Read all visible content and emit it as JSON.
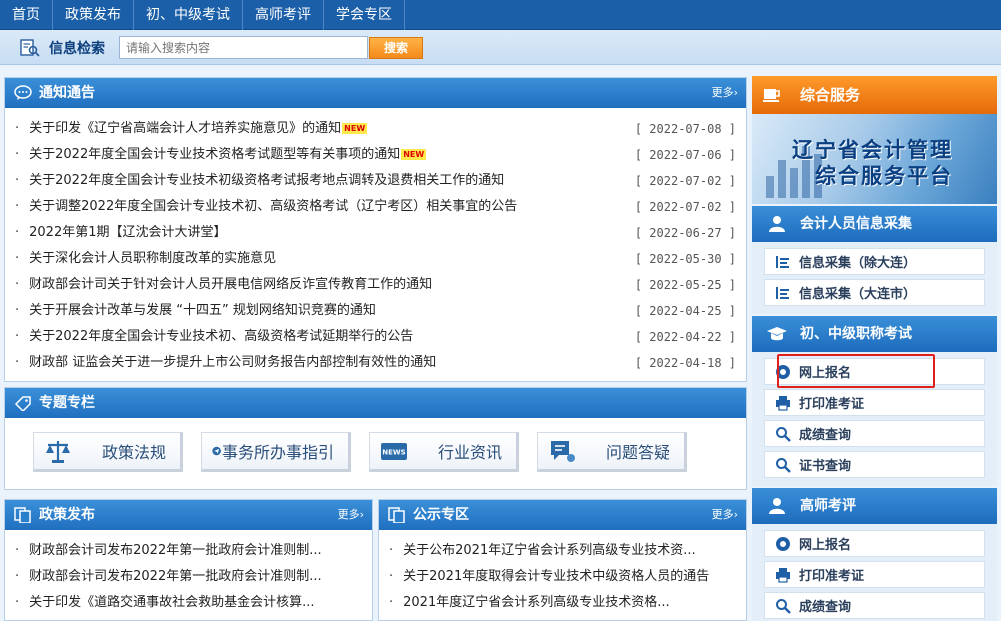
{
  "nav": [
    "首页",
    "政策发布",
    "初、中级考试",
    "高师考评",
    "学会专区"
  ],
  "search": {
    "label": "信息检索",
    "placeholder": "请输入搜索内容",
    "button": "搜索"
  },
  "notice": {
    "title": "通知通告",
    "more": "更多›",
    "items": [
      {
        "title": "关于印发《辽宁省高端会计人才培养实施意见》的通知",
        "new": "NEW",
        "date": "[ 2022-07-08 ]"
      },
      {
        "title": "关于2022年度全国会计专业技术资格考试题型等有关事项的通知",
        "new": "NEW",
        "date": "[ 2022-07-06 ]"
      },
      {
        "title": "关于2022年度全国会计专业技术初级资格考试报考地点调转及退费相关工作的通知",
        "new": "",
        "date": "[ 2022-07-02 ]"
      },
      {
        "title": "关于调整2022年度全国会计专业技术初、高级资格考试（辽宁考区）相关事宜的公告",
        "new": "",
        "date": "[ 2022-07-02 ]"
      },
      {
        "title": "2022年第1期【辽沈会计大讲堂】",
        "new": "",
        "date": "[ 2022-06-27 ]"
      },
      {
        "title": "关于深化会计人员职称制度改革的实施意见",
        "new": "",
        "date": "[ 2022-05-30 ]"
      },
      {
        "title": "财政部会计司关于针对会计人员开展电信网络反诈宣传教育工作的通知",
        "new": "",
        "date": "[ 2022-05-25 ]"
      },
      {
        "title": "关于开展会计改革与发展 “十四五” 规划网络知识竞赛的通知",
        "new": "",
        "date": "[ 2022-04-25 ]"
      },
      {
        "title": "关于2022年度全国会计专业技术初、高级资格考试延期举行的公告",
        "new": "",
        "date": "[ 2022-04-22 ]"
      },
      {
        "title": "财政部 证监会关于进一步提升上市公司财务报告内部控制有效性的通知",
        "new": "",
        "date": "[ 2022-04-18 ]"
      }
    ]
  },
  "topics": {
    "title": "专题专栏",
    "items": [
      {
        "label": "政策法规",
        "icon": "scale-icon"
      },
      {
        "label": "事务所办事指引",
        "icon": "send-icon"
      },
      {
        "label": "行业资讯",
        "icon": "news-icon"
      },
      {
        "label": "问题答疑",
        "icon": "chat-icon"
      }
    ]
  },
  "policy": {
    "title": "政策发布",
    "more": "更多›",
    "items": [
      "财政部会计司发布2022年第一批政府会计准则制...",
      "财政部会计司发布2022年第一批政府会计准则制...",
      "关于印发《道路交通事故社会救助基金会计核算..."
    ]
  },
  "publicity": {
    "title": "公示专区",
    "more": "更多›",
    "items": [
      "关于公布2021年辽宁省会计系列高级专业技术资...",
      "关于2021年度取得会计专业技术中级资格人员的通告",
      "2021年度辽宁省会计系列高级专业技术资格..."
    ]
  },
  "service": {
    "title": "综合服务",
    "banner_line1": "辽宁省会计管理",
    "banner_line2": "综合服务平台"
  },
  "collect": {
    "title": "会计人员信息采集",
    "items": [
      "信息采集（除大连）",
      "信息采集（大连市）"
    ]
  },
  "exam": {
    "title": "初、中级职称考试",
    "items": [
      "网上报名",
      "打印准考证",
      "成绩查询",
      "证书查询"
    ]
  },
  "senior": {
    "title": "高师考评",
    "items": [
      "网上报名",
      "打印准考证",
      "成绩查询"
    ]
  },
  "colors": {
    "nav": "#1b5fa8",
    "panel_head": "#2a7fcd",
    "accent_orange": "#f28a1a",
    "highlight": "#e0201a"
  }
}
